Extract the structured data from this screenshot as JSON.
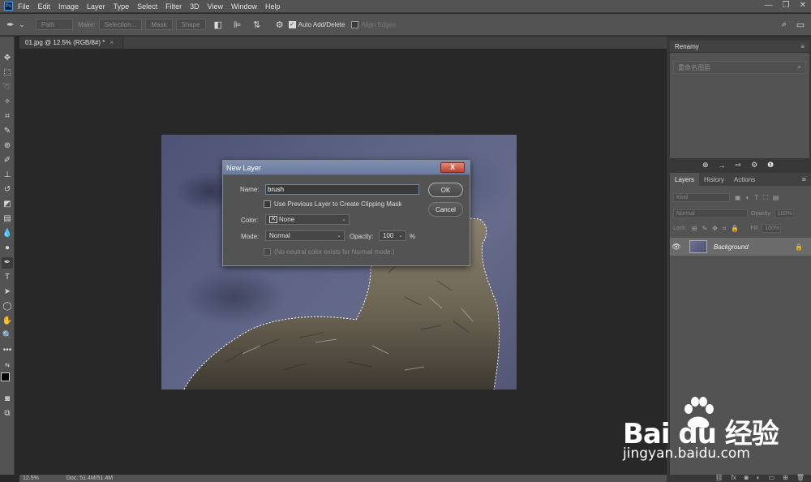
{
  "app": {
    "logo": "Ps"
  },
  "menu": [
    "File",
    "Edit",
    "Image",
    "Layer",
    "Type",
    "Select",
    "Filter",
    "3D",
    "View",
    "Window",
    "Help"
  ],
  "window_controls": [
    "—",
    "❐",
    "✕"
  ],
  "options_bar": {
    "path_btn": "Path",
    "make_label": "Make:",
    "selection_btn": "Selection...",
    "mask_btn": "Mask",
    "shape_btn": "Shape",
    "auto_add_delete": "Auto Add/Delete",
    "auto_add_delete_checked": true,
    "align_edges": "Align Edges",
    "align_edges_checked": false
  },
  "document": {
    "tab_title": "01.jpg @ 12.5% (RGB/8#) *",
    "close": "×"
  },
  "dialog": {
    "title": "New Layer",
    "close": "X",
    "name_label": "Name:",
    "name_value": "brush",
    "clipping_label": "Use Previous Layer to Create Clipping Mask",
    "color_label": "Color:",
    "color_value": "None",
    "mode_label": "Mode:",
    "mode_value": "Normal",
    "opacity_label": "Opacity:",
    "opacity_value": "100",
    "opacity_unit": "%",
    "neutral_label": "(No neutral color exists for Normal mode.)",
    "ok": "OK",
    "cancel": "Cancel"
  },
  "renamy": {
    "title": "Renamy",
    "search_placeholder": "重命名图层"
  },
  "layers": {
    "tabs": [
      "Layers",
      "History",
      "Actions"
    ],
    "kind": "Kind",
    "blend_mode": "Normal",
    "opacity_label": "Opacity:",
    "opacity_value": "100%",
    "lock_label": "Lock:",
    "fill_label": "Fill:",
    "fill_value": "100%",
    "background_name": "Background"
  },
  "status": {
    "zoom": "12.5%",
    "doc": "Doc: 51.4M/51.4M"
  },
  "watermark": {
    "logo": "Bai du 经验",
    "url": "jingyan.baidu.com"
  },
  "colors": {
    "accent": "#31a8ff",
    "dialog_title": "#7f8fae",
    "close_red": "#c0402e"
  }
}
